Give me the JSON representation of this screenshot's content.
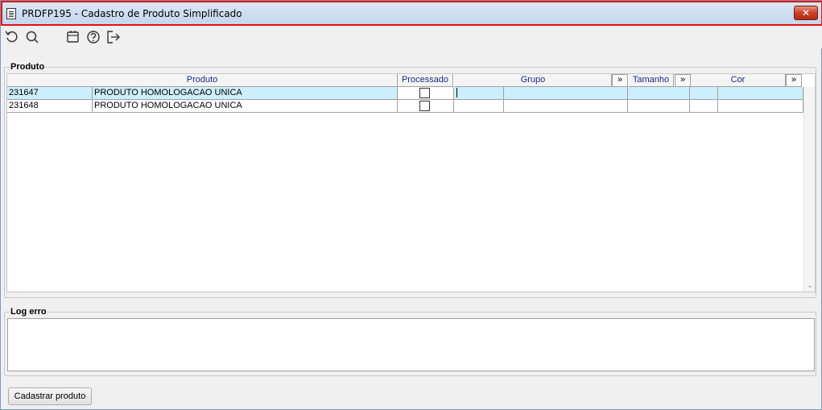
{
  "window": {
    "title": "PRDFP195 - Cadastro de Produto Simplificado",
    "close_glyph": "✕"
  },
  "toolbar": {
    "icons": [
      "refresh-icon",
      "search-icon",
      "calendar-icon",
      "help-icon",
      "exit-icon"
    ]
  },
  "produto_group": {
    "label": "Produto",
    "columns": {
      "produto": "Produto",
      "processado": "Processado",
      "grupo": "Grupo",
      "tamanho": "Tamanho",
      "cor": "Cor",
      "expand": "»"
    },
    "rows": [
      {
        "code": "231647",
        "name": "PRODUTO HOMOLOGACAO UNICA",
        "processado": false
      },
      {
        "code": "231648",
        "name": "PRODUTO HOMOLOGACAO UNICA",
        "processado": false
      }
    ]
  },
  "log_group": {
    "label": "Log erro",
    "text": ""
  },
  "actions": {
    "cadastrar_label": "Cadastrar produto"
  },
  "colors": {
    "title_border": "#e31212",
    "selected_row": "#cdeefc",
    "header_text": "#1a2a8a"
  }
}
